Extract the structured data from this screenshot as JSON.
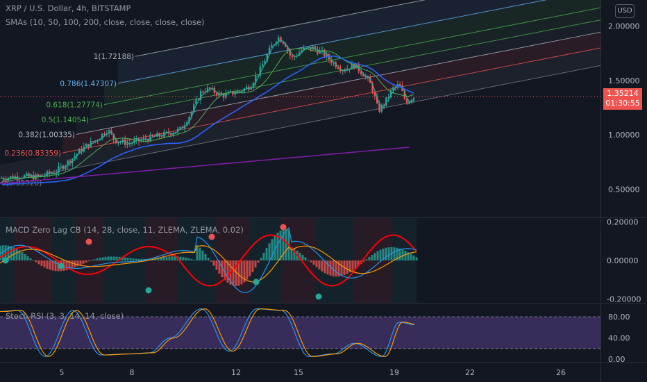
{
  "header": {
    "title": "XRP / U.S. Dollar, 4h, BITSTAMP",
    "indicators": "SMAs (10, 50, 100, 200, close, close, close, close)",
    "currency_button": "USD"
  },
  "price_badge": {
    "price": "1.35214",
    "countdown": "01:30:55"
  },
  "price_axis": {
    "ticks": [
      "2.00000",
      "1.50000",
      "1.00000",
      "0.50000"
    ],
    "tick_values": [
      2.0,
      1.5,
      1.0,
      0.5
    ],
    "range": [
      0.24,
      2.24
    ]
  },
  "fib_levels": [
    {
      "label": "0.236(0.83359)",
      "value": 0.83359,
      "color": "#ef5350"
    },
    {
      "label": "0.382(1.00335)",
      "value": 1.00335,
      "color": "#b2b5be"
    },
    {
      "label": "0.5(1.14054)",
      "value": 1.14054,
      "color": "#4caf50"
    },
    {
      "label": "0.618(1.27774)",
      "value": 1.27774,
      "color": "#4caf50"
    },
    {
      "label": "0.786(1.47307)",
      "value": 1.47307,
      "color": "#64b5f6"
    },
    {
      "label": "1(1.72188)",
      "value": 1.72188,
      "color": "#b2b5be"
    },
    {
      "label": "0(0.55920)",
      "value": 0.5592,
      "color": "#787b86"
    }
  ],
  "macd": {
    "title": "MACD Zero Lag CB (14, 28, close, 11, ZLEMA, ZLEMA, 0.02)",
    "ticks": [
      "0.20000",
      "0.00000",
      "-0.20000"
    ],
    "tick_values": [
      0.2,
      0.0,
      -0.2
    ],
    "range": [
      -0.22,
      0.22
    ]
  },
  "stoch_rsi": {
    "title": "Stoch RSI (3, 3, 14, 14, close)",
    "ticks": [
      "80.00",
      "40.00",
      "0.00"
    ],
    "tick_values": [
      80,
      40,
      0
    ],
    "range": [
      -5,
      105
    ],
    "band": [
      20,
      80
    ]
  },
  "time_axis": {
    "labels": [
      "5",
      "8",
      "12",
      "15",
      "19",
      "22",
      "26"
    ]
  },
  "colors": {
    "background": "#131722",
    "up": "#26a69a",
    "down": "#ef5350",
    "sma10": "#26a69a",
    "sma200": "#2962ff",
    "sma_slow": "#7b1fa2"
  }
}
